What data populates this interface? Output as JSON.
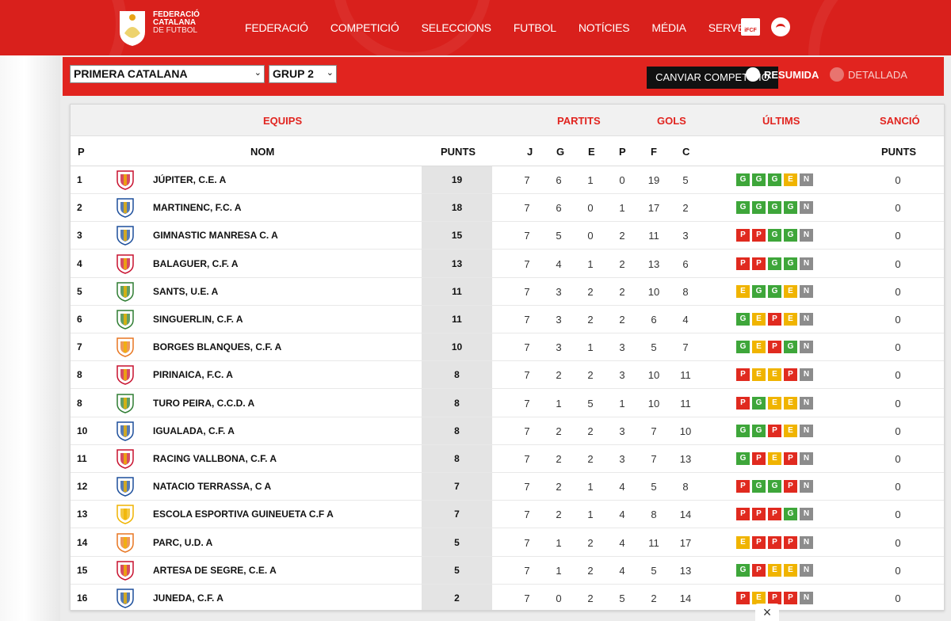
{
  "brand": {
    "line1": "FEDERACIÓ",
    "line2": "CATALANA",
    "line3": "DE FUTBOL"
  },
  "nav": [
    "FEDERACIÓ",
    "COMPETICIÓ",
    "SELECCIONS",
    "FUTBOL",
    "NOTÍCIES",
    "MÉDIA",
    "SERVEIS"
  ],
  "nav_icons": {
    "icfc": "iFCF"
  },
  "filters": {
    "competition": "PRIMERA CATALANA",
    "group": "GRUP 2",
    "change_button": "CANVIAR COMPETICIÓ",
    "view_summary": "RESUMIDA",
    "view_detailed": "DETALLADA"
  },
  "table": {
    "group_headers": {
      "teams": "EQUIPS",
      "matches": "PARTITS",
      "goals": "GOLS",
      "last": "ÚLTIMS",
      "sanction": "SANCIÓ"
    },
    "columns": {
      "pos": "P",
      "name": "NOM",
      "points": "PUNTS",
      "j": "J",
      "g": "G",
      "e": "E",
      "p": "P",
      "f": "F",
      "c": "C",
      "sanction_points": "PUNTS"
    },
    "rows": [
      {
        "pos": "1",
        "name": "JÚPITER, C.E. A",
        "pts": "19",
        "j": "7",
        "g": "6",
        "e": "1",
        "p": "0",
        "f": "19",
        "c": "5",
        "form": [
          "G",
          "G",
          "G",
          "E",
          "N"
        ],
        "sanc": "0"
      },
      {
        "pos": "2",
        "name": "MARTINENC, F.C. A",
        "pts": "18",
        "j": "7",
        "g": "6",
        "e": "0",
        "p": "1",
        "f": "17",
        "c": "2",
        "form": [
          "G",
          "G",
          "G",
          "G",
          "N"
        ],
        "sanc": "0"
      },
      {
        "pos": "3",
        "name": "GIMNASTIC MANRESA C. A",
        "pts": "15",
        "j": "7",
        "g": "5",
        "e": "0",
        "p": "2",
        "f": "11",
        "c": "3",
        "form": [
          "P",
          "P",
          "G",
          "G",
          "N"
        ],
        "sanc": "0"
      },
      {
        "pos": "4",
        "name": "BALAGUER, C.F. A",
        "pts": "13",
        "j": "7",
        "g": "4",
        "e": "1",
        "p": "2",
        "f": "13",
        "c": "6",
        "form": [
          "P",
          "P",
          "G",
          "G",
          "N"
        ],
        "sanc": "0"
      },
      {
        "pos": "5",
        "name": "SANTS, U.E. A",
        "pts": "11",
        "j": "7",
        "g": "3",
        "e": "2",
        "p": "2",
        "f": "10",
        "c": "8",
        "form": [
          "E",
          "G",
          "G",
          "E",
          "N"
        ],
        "sanc": "0"
      },
      {
        "pos": "6",
        "name": "SINGUERLIN, C.F. A",
        "pts": "11",
        "j": "7",
        "g": "3",
        "e": "2",
        "p": "2",
        "f": "6",
        "c": "4",
        "form": [
          "G",
          "E",
          "P",
          "E",
          "N"
        ],
        "sanc": "0"
      },
      {
        "pos": "7",
        "name": "BORGES BLANQUES, C.F. A",
        "pts": "10",
        "j": "7",
        "g": "3",
        "e": "1",
        "p": "3",
        "f": "5",
        "c": "7",
        "form": [
          "G",
          "E",
          "P",
          "G",
          "N"
        ],
        "sanc": "0"
      },
      {
        "pos": "8",
        "name": "PIRINAICA, F.C. A",
        "pts": "8",
        "j": "7",
        "g": "2",
        "e": "2",
        "p": "3",
        "f": "10",
        "c": "11",
        "form": [
          "P",
          "E",
          "E",
          "P",
          "N"
        ],
        "sanc": "0"
      },
      {
        "pos": "8",
        "name": "TURO PEIRA, C.C.D. A",
        "pts": "8",
        "j": "7",
        "g": "1",
        "e": "5",
        "p": "1",
        "f": "10",
        "c": "11",
        "form": [
          "P",
          "G",
          "E",
          "E",
          "N"
        ],
        "sanc": "0"
      },
      {
        "pos": "10",
        "name": "IGUALADA, C.F. A",
        "pts": "8",
        "j": "7",
        "g": "2",
        "e": "2",
        "p": "3",
        "f": "7",
        "c": "10",
        "form": [
          "G",
          "G",
          "P",
          "E",
          "N"
        ],
        "sanc": "0"
      },
      {
        "pos": "11",
        "name": "RACING VALLBONA, C.F. A",
        "pts": "8",
        "j": "7",
        "g": "2",
        "e": "2",
        "p": "3",
        "f": "7",
        "c": "13",
        "form": [
          "G",
          "P",
          "E",
          "P",
          "N"
        ],
        "sanc": "0"
      },
      {
        "pos": "12",
        "name": "NATACIO TERRASSA, C A",
        "pts": "7",
        "j": "7",
        "g": "2",
        "e": "1",
        "p": "4",
        "f": "5",
        "c": "8",
        "form": [
          "P",
          "G",
          "G",
          "P",
          "N"
        ],
        "sanc": "0"
      },
      {
        "pos": "13",
        "name": "ESCOLA ESPORTIVA GUINEUETA C.F A",
        "pts": "7",
        "j": "7",
        "g": "2",
        "e": "1",
        "p": "4",
        "f": "8",
        "c": "14",
        "form": [
          "P",
          "P",
          "P",
          "G",
          "N"
        ],
        "sanc": "0"
      },
      {
        "pos": "14",
        "name": "PARC, U.D. A",
        "pts": "5",
        "j": "7",
        "g": "1",
        "e": "2",
        "p": "4",
        "f": "11",
        "c": "17",
        "form": [
          "E",
          "P",
          "P",
          "P",
          "N"
        ],
        "sanc": "0"
      },
      {
        "pos": "15",
        "name": "ARTESA DE SEGRE, C.E. A",
        "pts": "5",
        "j": "7",
        "g": "1",
        "e": "2",
        "p": "4",
        "f": "5",
        "c": "13",
        "form": [
          "G",
          "P",
          "E",
          "E",
          "N"
        ],
        "sanc": "0"
      },
      {
        "pos": "16",
        "name": "JUNEDA, C.F. A",
        "pts": "2",
        "j": "7",
        "g": "0",
        "e": "2",
        "p": "5",
        "f": "2",
        "c": "14",
        "form": [
          "P",
          "E",
          "P",
          "P",
          "N"
        ],
        "sanc": "0"
      }
    ]
  },
  "crest_colors": [
    "#c8102e",
    "#1d4f9c",
    "#1d4f9c",
    "#c8102e",
    "#2e7d32",
    "#2e7d32",
    "#e87722",
    "#c8102e",
    "#2e7d32",
    "#1d4f9c",
    "#c8102e",
    "#1d4f9c",
    "#f0b400",
    "#e87722",
    "#c8102e",
    "#1d4f9c"
  ],
  "close_icon": "×"
}
